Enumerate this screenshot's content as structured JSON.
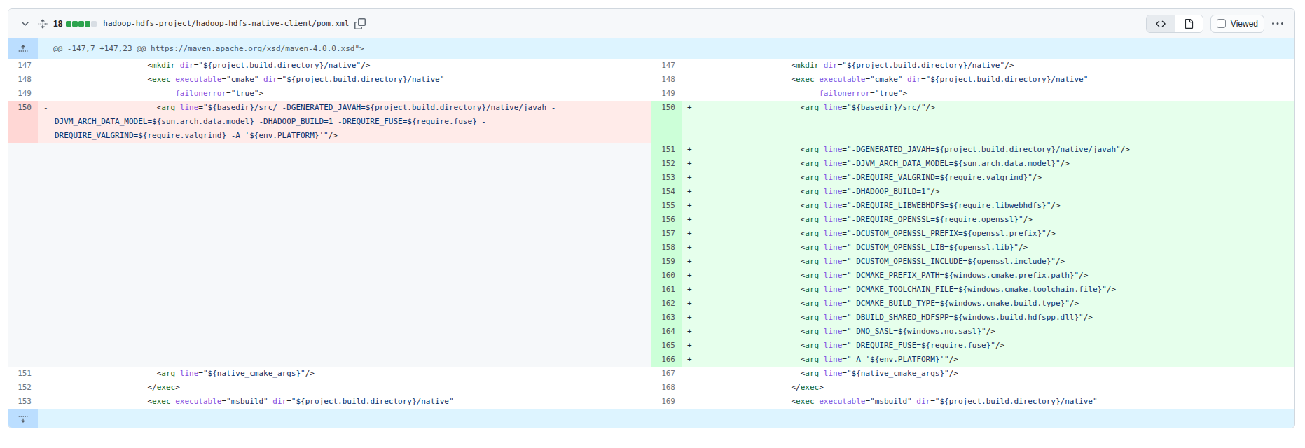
{
  "file": {
    "changes_count": "18",
    "diffstat_squares": [
      "add",
      "add",
      "add",
      "add",
      "neutral"
    ],
    "path": "hadoop-hdfs-project/hadoop-hdfs-native-client/pom.xml",
    "viewed_label": "Viewed",
    "icons": {
      "collapse": "chevron-down-icon",
      "expand_all": "unfold-icon",
      "copy_path": "copy-icon",
      "source_view": "code-icon",
      "rendered_view": "file-icon",
      "overflow_menu": "kebab-horizontal-icon",
      "expand_hunk_up": "fold-up-icon",
      "expand_hunk_down": "fold-down-icon"
    }
  },
  "hunk": {
    "header": "@@ -147,7 +147,23 @@ https://maven.apache.org/xsd/maven-4.0.0.xsd\">"
  },
  "colors": {
    "border": "#d0d7de",
    "header_bg": "#f6f8fa",
    "hunk_bg": "#ddf4ff",
    "hunk_gutter_bg": "#bbdeff",
    "deletion_line_bg": "#ffebe9",
    "deletion_gutter_bg": "#ffd7d5",
    "addition_line_bg": "#e6ffec",
    "addition_gutter_bg": "#ccffd8",
    "empty_cell_bg": "#f6f8fa",
    "diffstat_addition": "#2da44e",
    "diffstat_neutral": "#d8dee4",
    "syntax_tag": "#116329",
    "syntax_attr": "#8250df",
    "syntax_string": "#0a3069"
  },
  "diff": {
    "rows": [
      {
        "left": {
          "num": "147",
          "type": "ctx",
          "text": "                    <mkdir dir=\"${project.build.directory}/native\"/>"
        },
        "right": {
          "num": "147",
          "type": "ctx",
          "text": "                    <mkdir dir=\"${project.build.directory}/native\"/>"
        }
      },
      {
        "left": {
          "num": "148",
          "type": "ctx",
          "text": "                    <exec executable=\"cmake\" dir=\"${project.build.directory}/native\""
        },
        "right": {
          "num": "148",
          "type": "ctx",
          "text": "                    <exec executable=\"cmake\" dir=\"${project.build.directory}/native\""
        }
      },
      {
        "left": {
          "num": "149",
          "type": "ctx",
          "text": "                          failonerror=\"true\">"
        },
        "right": {
          "num": "149",
          "type": "ctx",
          "text": "                          failonerror=\"true\">"
        }
      },
      {
        "left": {
          "num": "150",
          "type": "del",
          "sign": "-",
          "text": "                      <arg line=\"${basedir}/src/ -DGENERATED_JAVAH=${project.build.directory}/native/javah -DJVM_ARCH_DATA_MODEL=${sun.arch.data.model} -DHADOOP_BUILD=1 -DREQUIRE_FUSE=${require.fuse} -DREQUIRE_VALGRIND=${require.valgrind} -A '${env.PLATFORM}'\"/>"
        },
        "right": {
          "num": "150",
          "type": "add",
          "sign": "+",
          "text": "                      <arg line=\"${basedir}/src/\"/>"
        }
      },
      {
        "left": {
          "type": "empty"
        },
        "right": {
          "num": "151",
          "type": "add",
          "sign": "+",
          "text": "                      <arg line=\"-DGENERATED_JAVAH=${project.build.directory}/native/javah\"/>"
        }
      },
      {
        "left": {
          "type": "empty"
        },
        "right": {
          "num": "152",
          "type": "add",
          "sign": "+",
          "text": "                      <arg line=\"-DJVM_ARCH_DATA_MODEL=${sun.arch.data.model}\"/>"
        }
      },
      {
        "left": {
          "type": "empty"
        },
        "right": {
          "num": "153",
          "type": "add",
          "sign": "+",
          "text": "                      <arg line=\"-DREQUIRE_VALGRIND=${require.valgrind}\"/>"
        }
      },
      {
        "left": {
          "type": "empty"
        },
        "right": {
          "num": "154",
          "type": "add",
          "sign": "+",
          "text": "                      <arg line=\"-DHADOOP_BUILD=1\"/>"
        }
      },
      {
        "left": {
          "type": "empty"
        },
        "right": {
          "num": "155",
          "type": "add",
          "sign": "+",
          "text": "                      <arg line=\"-DREQUIRE_LIBWEBHDFS=${require.libwebhdfs}\"/>"
        }
      },
      {
        "left": {
          "type": "empty"
        },
        "right": {
          "num": "156",
          "type": "add",
          "sign": "+",
          "text": "                      <arg line=\"-DREQUIRE_OPENSSL=${require.openssl}\"/>"
        }
      },
      {
        "left": {
          "type": "empty"
        },
        "right": {
          "num": "157",
          "type": "add",
          "sign": "+",
          "text": "                      <arg line=\"-DCUSTOM_OPENSSL_PREFIX=${openssl.prefix}\"/>"
        }
      },
      {
        "left": {
          "type": "empty"
        },
        "right": {
          "num": "158",
          "type": "add",
          "sign": "+",
          "text": "                      <arg line=\"-DCUSTOM_OPENSSL_LIB=${openssl.lib}\"/>"
        }
      },
      {
        "left": {
          "type": "empty"
        },
        "right": {
          "num": "159",
          "type": "add",
          "sign": "+",
          "text": "                      <arg line=\"-DCUSTOM_OPENSSL_INCLUDE=${openssl.include}\"/>"
        }
      },
      {
        "left": {
          "type": "empty"
        },
        "right": {
          "num": "160",
          "type": "add",
          "sign": "+",
          "text": "                      <arg line=\"-DCMAKE_PREFIX_PATH=${windows.cmake.prefix.path}\"/>"
        }
      },
      {
        "left": {
          "type": "empty"
        },
        "right": {
          "num": "161",
          "type": "add",
          "sign": "+",
          "text": "                      <arg line=\"-DCMAKE_TOOLCHAIN_FILE=${windows.cmake.toolchain.file}\"/>"
        }
      },
      {
        "left": {
          "type": "empty"
        },
        "right": {
          "num": "162",
          "type": "add",
          "sign": "+",
          "text": "                      <arg line=\"-DCMAKE_BUILD_TYPE=${windows.cmake.build.type}\"/>"
        }
      },
      {
        "left": {
          "type": "empty"
        },
        "right": {
          "num": "163",
          "type": "add",
          "sign": "+",
          "text": "                      <arg line=\"-DBUILD_SHARED_HDFSPP=${windows.build.hdfspp.dll}\"/>"
        }
      },
      {
        "left": {
          "type": "empty"
        },
        "right": {
          "num": "164",
          "type": "add",
          "sign": "+",
          "text": "                      <arg line=\"-DNO_SASL=${windows.no.sasl}\"/>"
        }
      },
      {
        "left": {
          "type": "empty"
        },
        "right": {
          "num": "165",
          "type": "add",
          "sign": "+",
          "text": "                      <arg line=\"-DREQUIRE_FUSE=${require.fuse}\"/>"
        }
      },
      {
        "left": {
          "type": "empty"
        },
        "right": {
          "num": "166",
          "type": "add",
          "sign": "+",
          "text": "                      <arg line=\"-A '${env.PLATFORM}'\"/>"
        }
      },
      {
        "left": {
          "num": "151",
          "type": "ctx",
          "text": "                      <arg line=\"${native_cmake_args}\"/>"
        },
        "right": {
          "num": "167",
          "type": "ctx",
          "text": "                      <arg line=\"${native_cmake_args}\"/>"
        }
      },
      {
        "left": {
          "num": "152",
          "type": "ctx",
          "text": "                    </exec>"
        },
        "right": {
          "num": "168",
          "type": "ctx",
          "text": "                    </exec>"
        }
      },
      {
        "left": {
          "num": "153",
          "type": "ctx",
          "text": "                    <exec executable=\"msbuild\" dir=\"${project.build.directory}/native\""
        },
        "right": {
          "num": "169",
          "type": "ctx",
          "text": "                    <exec executable=\"msbuild\" dir=\"${project.build.directory}/native\""
        }
      }
    ]
  }
}
